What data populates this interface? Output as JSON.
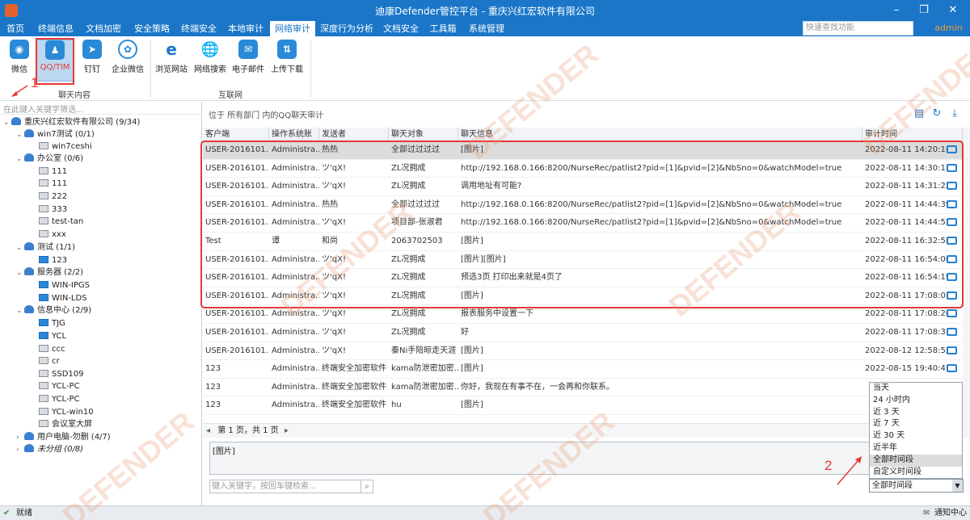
{
  "app": {
    "title": "迪康Defender管控平台 - 重庆兴红宏软件有限公司",
    "quick_search_placeholder": "快速查找功能",
    "user": "admin"
  },
  "menu": [
    "首页",
    "终端信息",
    "文档加密",
    "安全策略",
    "终端安全",
    "本地审计",
    "网络审计",
    "深度行为分析",
    "文档安全",
    "工具箱",
    "系统管理"
  ],
  "ribbon": {
    "chat_group_label": "聊天内容",
    "internet_group_label": "互联网",
    "chat_items": [
      "微信",
      "QQ/TIM",
      "钉钉",
      "企业微信"
    ],
    "internet_items": [
      "浏览网站",
      "网络搜索",
      "电子邮件",
      "上传下载"
    ]
  },
  "tree": {
    "filter_placeholder": "在此键入关键字筛选...",
    "nodes": [
      "重庆兴红宏软件有限公司 (9/34)",
      "win7测试 (0/1)",
      "win7ceshi",
      "办公室 (0/6)",
      "111",
      "111",
      "222",
      "333",
      "test-tan",
      "xxx",
      "测试 (1/1)",
      "123",
      "服务器 (2/2)",
      "WIN-IPGS",
      "WIN-LDS",
      "信息中心 (2/9)",
      "TJG",
      "YCL",
      "ccc",
      "cr",
      "SSD109",
      "YCL-PC",
      "YCL-PC",
      "YCL-win10",
      "会议室大屏",
      "用户电脑-勿删 (4/7)",
      "未分组 (0/8)"
    ]
  },
  "breadcrumb": "位于 所有部门 内的QQ聊天审计",
  "columns": [
    "客户端",
    "操作系统账户",
    "发送者",
    "聊天对象",
    "聊天信息",
    "审计时间"
  ],
  "rows": [
    [
      "USER-2016101...",
      "Administra...",
      "热热",
      "全部过过过过",
      "[图片]",
      "2022-08-11 14:20:18"
    ],
    [
      "USER-2016101...",
      "Administra...",
      "ツ'qX!",
      "ZL况拥成",
      "http://192.168.0.166:8200/NurseRec/patlist2?pid=[1]&pvid=[2]&NbSno=0&watchModel=true",
      "2022-08-11 14:30:17"
    ],
    [
      "USER-2016101...",
      "Administra...",
      "ツ'qX!",
      "ZL况拥成",
      "调用地址有可能?",
      "2022-08-11 14:31:22"
    ],
    [
      "USER-2016101...",
      "Administra...",
      "热热",
      "全部过过过过",
      "http://192.168.0.166:8200/NurseRec/patlist2?pid=[1]&pvid=[2]&NbSno=0&watchModel=true",
      "2022-08-11 14:44:39"
    ],
    [
      "USER-2016101...",
      "Administra...",
      "ツ'qX!",
      "项目部-张淑君",
      "http://192.168.0.166:8200/NurseRec/patlist2?pid=[1]&pvid=[2]&NbSno=0&watchModel=true",
      "2022-08-11 14:44:52"
    ],
    [
      "Test",
      "谭",
      "和尚",
      "2063702503",
      "[图片]",
      "2022-08-11 16:32:58"
    ],
    [
      "USER-2016101...",
      "Administra...",
      "ツ'qX!",
      "ZL况拥成",
      "[图片][图片]",
      "2022-08-11 16:54:06"
    ],
    [
      "USER-2016101...",
      "Administra...",
      "ツ'qX!",
      "ZL况拥成",
      "预选3页 打印出来就是4页了",
      "2022-08-11 16:54:19"
    ],
    [
      "USER-2016101...",
      "Administra...",
      "ツ'qX!",
      "ZL况拥成",
      "[图片]",
      "2022-08-11 17:08:07"
    ],
    [
      "USER-2016101...",
      "Administra...",
      "ツ'qX!",
      "ZL况拥成",
      "报表服务中设置一下",
      "2022-08-11 17:08:20"
    ],
    [
      "USER-2016101...",
      "Administra...",
      "ツ'qX!",
      "ZL况拥成",
      "好",
      "2022-08-11 17:08:31"
    ],
    [
      "USER-2016101...",
      "Administra...",
      "ツ'qX!",
      "秦Ni手陪晾走天涯",
      "[图片]",
      "2022-08-12 12:58:52"
    ],
    [
      "123",
      "Administra...",
      "终端安全加密软件",
      "kama防泄密加密...",
      "[图片]",
      "2022-08-15 19:40:41"
    ],
    [
      "123",
      "Administra...",
      "终端安全加密软件",
      "kama防泄密加密...",
      "你好，我现在有事不在，一会再和你联系。",
      ""
    ],
    [
      "123",
      "Administra...",
      "终端安全加密软件",
      "hu",
      "[图片]",
      ""
    ]
  ],
  "pager": "第 1 页，共 1 页",
  "detail": "[图片]",
  "keyword_placeholder": "键入关键字，按回车键检索...",
  "time_filter": {
    "options": [
      "当天",
      "24 小时内",
      "近 3 天",
      "近 7 天",
      "近 30 天",
      "近半年",
      "全部时间段",
      "自定义时间段"
    ],
    "selected": "全部时间段"
  },
  "status": {
    "left": "就绪",
    "right": "通知中心"
  },
  "annotations": {
    "a1": "1",
    "a2": "2"
  },
  "watermark": {
    "en": "DEFENDER",
    "cn": "迪 康 软 件"
  }
}
